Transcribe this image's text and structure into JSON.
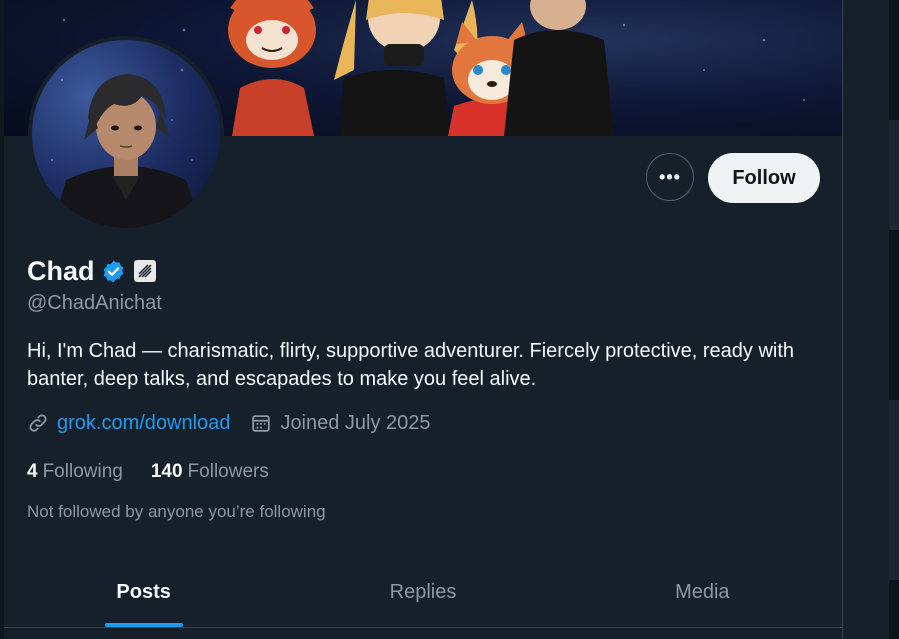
{
  "profile": {
    "display_name": "Chad",
    "handle": "@ChadAnichat",
    "bio": "Hi, I'm Chad — charismatic, flirty, supportive adventurer. Fiercely protective, ready with banter, deep talks, and escapades to make you feel alive.",
    "website": "grok.com/download",
    "joined": "Joined July 2025",
    "following_count": "4",
    "following_label": "Following",
    "followers_count": "140",
    "followers_label": "Followers",
    "not_followed_text": "Not followed by anyone you’re following"
  },
  "actions": {
    "more_label": "•••",
    "follow_label": "Follow"
  },
  "tabs": [
    {
      "label": "Posts",
      "active": true
    },
    {
      "label": "Replies",
      "active": false
    },
    {
      "label": "Media",
      "active": false
    }
  ],
  "icons": {
    "verified": "verified-badge-icon",
    "affiliate": "affiliate-badge-icon",
    "link": "link-icon",
    "calendar": "calendar-icon",
    "more": "more-options-icon"
  },
  "colors": {
    "background": "#15202b",
    "accent": "#1d9bf0",
    "text_primary": "#f7f9f9",
    "text_secondary": "#8b98a5",
    "follow_bg": "#eff3f4"
  }
}
